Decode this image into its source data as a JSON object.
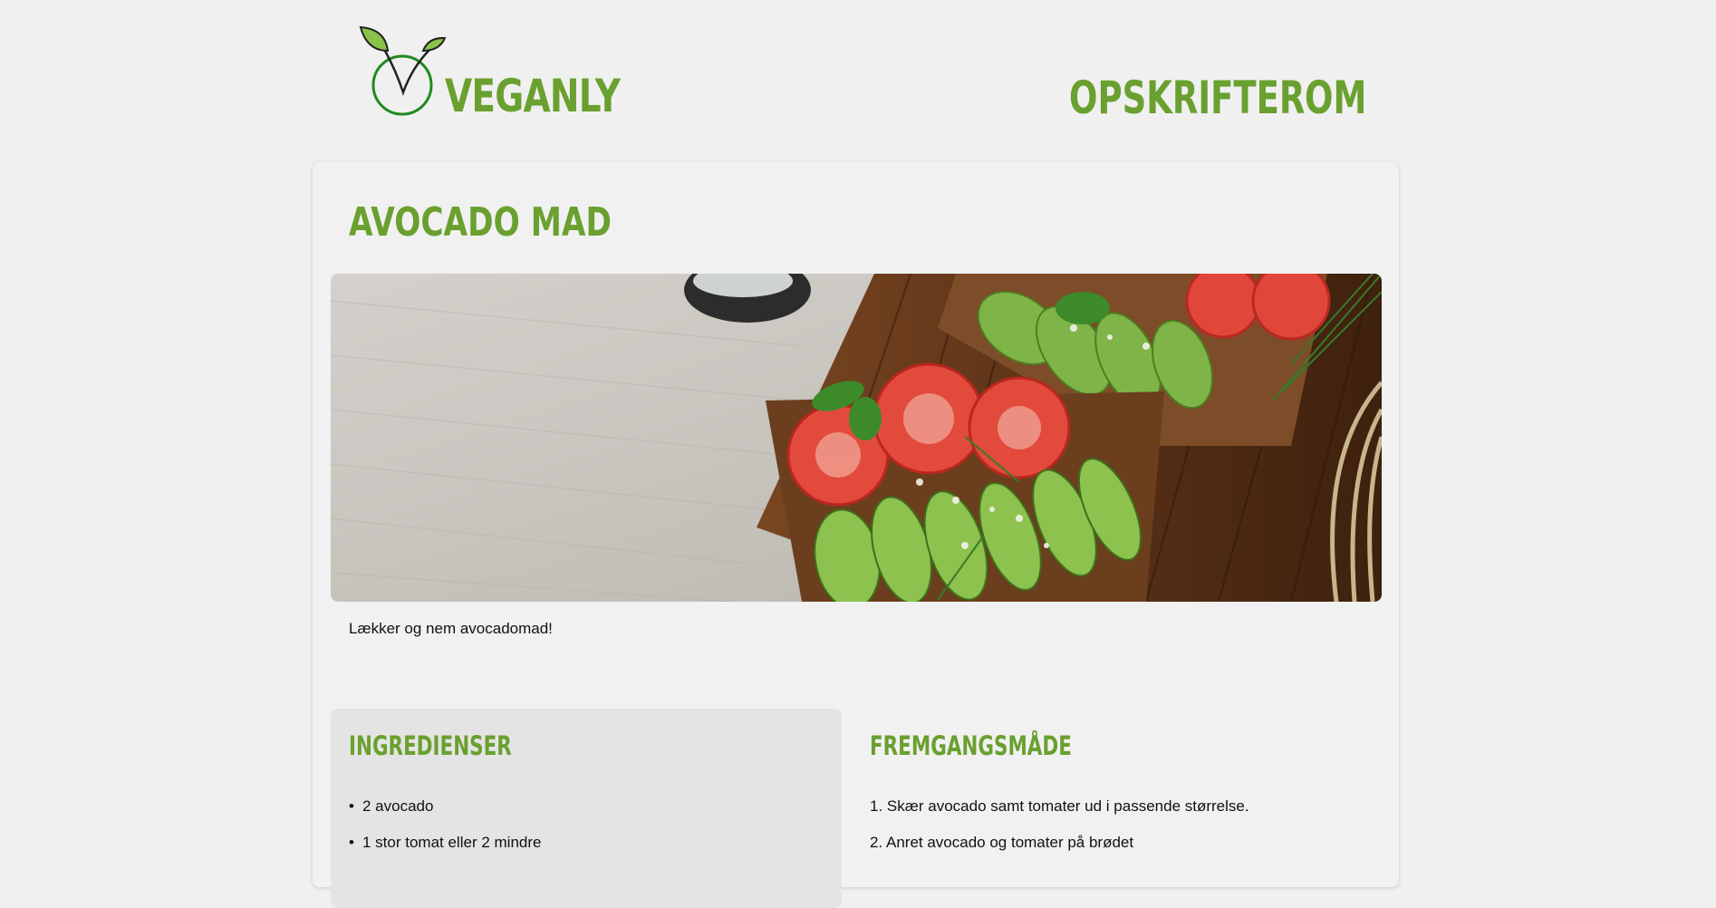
{
  "header": {
    "brand": "VEGANLY",
    "logo_icon": "sprout-v-icon",
    "nav": [
      {
        "label": "OPSKRIFTER"
      },
      {
        "label": "OM"
      }
    ]
  },
  "recipe": {
    "title": "AVOCADO MAD",
    "image_description": "avocado-toast-photo",
    "description": "Lækker og nem avocadomad!",
    "ingredients": {
      "heading": "INGREDIENSER",
      "items": [
        "2 avocado",
        "1 stor tomat eller 2 mindre"
      ]
    },
    "method": {
      "heading": "FREMGANGSMÅDE",
      "steps": [
        {
          "number": "1.",
          "text": "Skær avocado samt tomater ud i passende størrelse."
        },
        {
          "number": "2.",
          "text": "Anret avocado og tomater på brødet"
        }
      ]
    }
  },
  "colors": {
    "accent": "#6aa02f",
    "background": "#f0f0f0",
    "card": "#f1f1f1",
    "ingredients_panel": "#e4e4e4",
    "text": "#111111"
  }
}
